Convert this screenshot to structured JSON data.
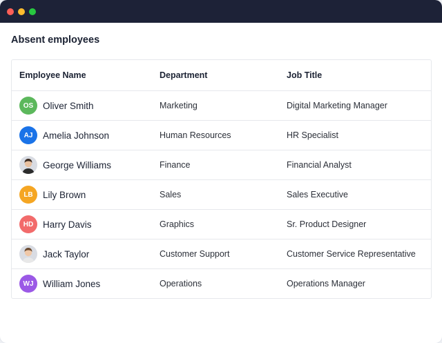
{
  "window": {
    "controls": [
      {
        "name": "close",
        "color": "#ff5f57"
      },
      {
        "name": "minimize",
        "color": "#febc2e"
      },
      {
        "name": "maximize",
        "color": "#28c840"
      }
    ]
  },
  "page": {
    "title": "Absent employees"
  },
  "table": {
    "columns": [
      "Employee Name",
      "Department",
      "Job Title"
    ],
    "rows": [
      {
        "initials": "OS",
        "avatar_color": "#5cb85c",
        "name": "Oliver Smith",
        "department": "Marketing",
        "job_title": "Digital Marketing Manager"
      },
      {
        "initials": "AJ",
        "avatar_color": "#1a73e8",
        "name": "Amelia Johnson",
        "department": "Human Resources",
        "job_title": "HR Specialist"
      },
      {
        "initials": "",
        "avatar_icon": "person-photo-icon",
        "name": "George Williams",
        "department": "Finance",
        "job_title": "Financial Analyst"
      },
      {
        "initials": "LB",
        "avatar_color": "#f5a623",
        "name": "Lily Brown",
        "department": "Sales",
        "job_title": "Sales Executive"
      },
      {
        "initials": "HD",
        "avatar_color": "#f26b6b",
        "name": "Harry Davis",
        "department": "Graphics",
        "job_title": "Sr. Product Designer"
      },
      {
        "initials": "",
        "avatar_icon": "person-photo-icon",
        "name": "Jack Taylor",
        "department": "Customer Support",
        "job_title": "Customer Service Representative"
      },
      {
        "initials": "WJ",
        "avatar_color": "#9b59e6",
        "name": "William Jones",
        "department": "Operations",
        "job_title": "Operations Manager"
      }
    ]
  }
}
